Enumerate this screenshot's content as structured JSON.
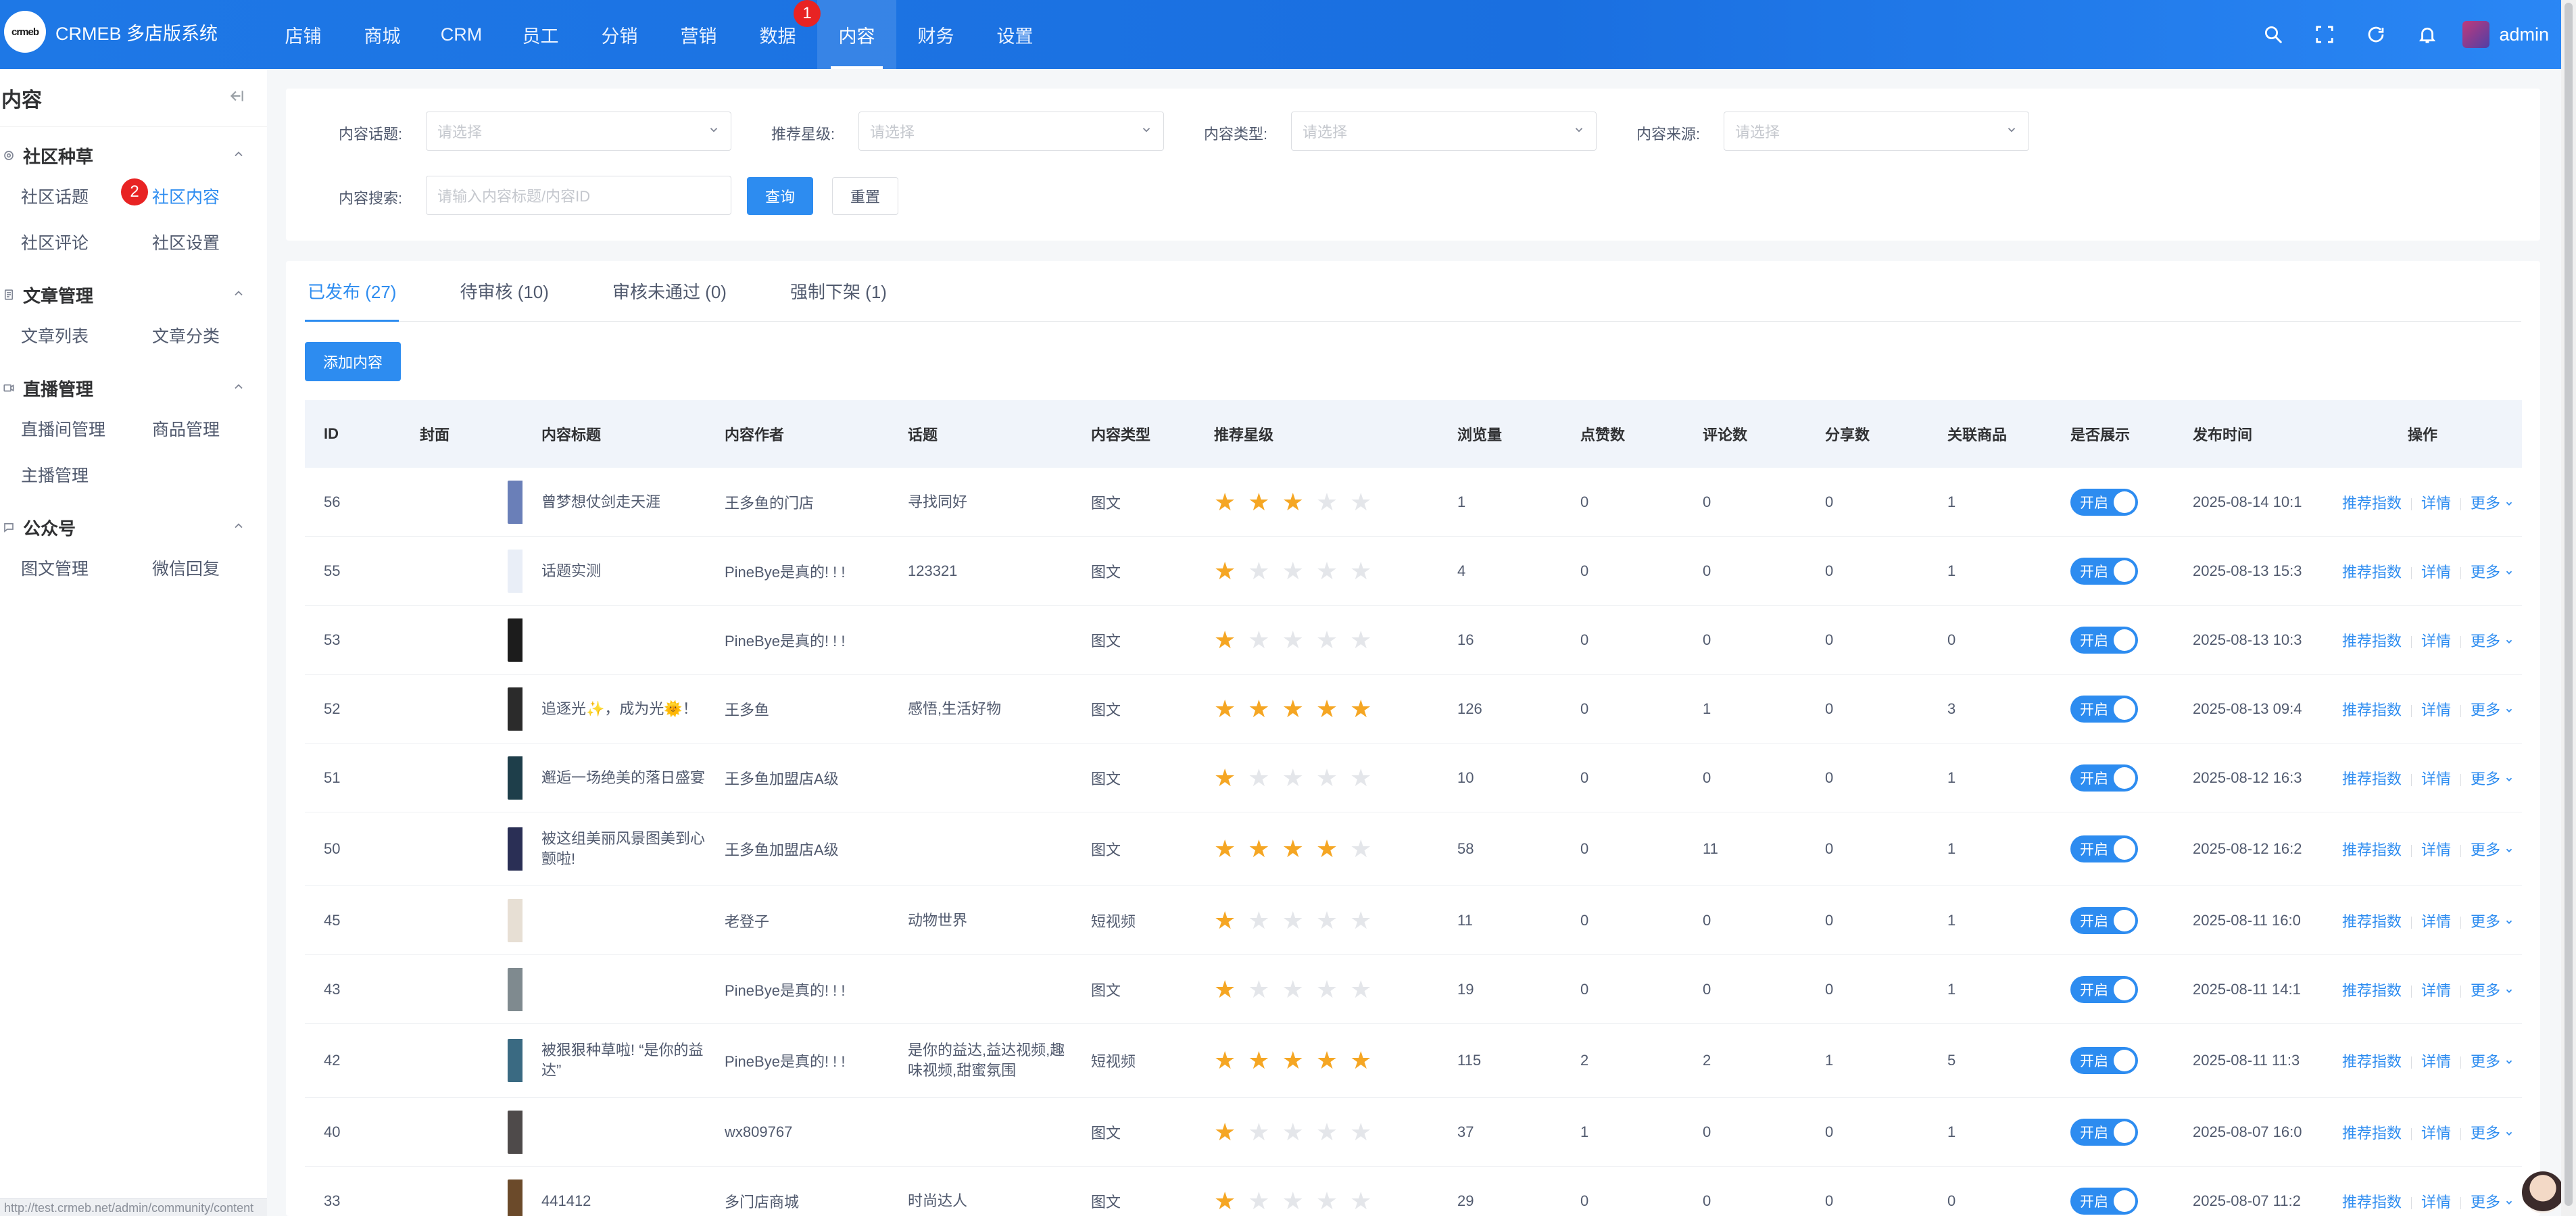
{
  "app": {
    "title": "CRMEB 多店版系统",
    "logo_text": "crmeb"
  },
  "topnav": [
    "店铺",
    "商城",
    "CRM",
    "员工",
    "分销",
    "营销",
    "数据",
    "内容",
    "财务",
    "设置"
  ],
  "topnav_active": "内容",
  "badges": {
    "one": "1",
    "two": "2"
  },
  "user": {
    "name": "admin"
  },
  "sidebar": {
    "title": "内容",
    "groups": [
      {
        "title": "社区种草",
        "icon": "circle-icon",
        "items": [
          "社区话题",
          "社区内容",
          "社区评论",
          "社区设置"
        ]
      },
      {
        "title": "文章管理",
        "icon": "document-icon",
        "items": [
          "文章列表",
          "文章分类"
        ]
      },
      {
        "title": "直播管理",
        "icon": "video-icon",
        "items": [
          "直播间管理",
          "商品管理",
          "主播管理"
        ]
      },
      {
        "title": "公众号",
        "icon": "chat-icon",
        "items": [
          "图文管理",
          "微信回复"
        ]
      }
    ],
    "active_item": "社区内容",
    "status_url": "http://test.crmeb.net/admin/community/content"
  },
  "search": {
    "topic_label": "内容话题:",
    "star_label": "推荐星级:",
    "type_label": "内容类型:",
    "source_label": "内容来源:",
    "keyword_label": "内容搜索:",
    "select_placeholder": "请选择",
    "keyword_placeholder": "请输入内容标题/内容ID",
    "query_button": "查询",
    "reset_button": "重置"
  },
  "tabs": [
    "已发布 (27)",
    "待审核 (10)",
    "审核未通过 (0)",
    "强制下架 (1)"
  ],
  "add_button": "添加内容",
  "table": {
    "headers": [
      "ID",
      "封面",
      "内容标题",
      "内容作者",
      "话题",
      "内容类型",
      "推荐星级",
      "浏览量",
      "点赞数",
      "评论数",
      "分享数",
      "关联商品",
      "是否展示",
      "发布时间",
      "操作"
    ],
    "switch_label": "开启",
    "op_labels": [
      "推荐指数",
      "详情",
      "更多"
    ],
    "rows": [
      {
        "id": "56",
        "cover": "#6a7fb8",
        "title": "曾梦想仗剑走天涯",
        "author": "王多鱼的门店",
        "topic": "寻找同好",
        "type": "图文",
        "stars": 3,
        "views": "1",
        "likes": "0",
        "comments": "0",
        "shares": "0",
        "goods": "1",
        "time": "2025-08-14 10:1"
      },
      {
        "id": "55",
        "cover": "#e9eef7",
        "title": "话题实测",
        "author": "PineBye是真的! ! !",
        "topic": "123321",
        "type": "图文",
        "stars": 1,
        "views": "4",
        "likes": "0",
        "comments": "0",
        "shares": "0",
        "goods": "1",
        "time": "2025-08-13 15:3"
      },
      {
        "id": "53",
        "cover": "#1c1c1c",
        "title": "",
        "author": "PineBye是真的! ! !",
        "topic": "",
        "type": "图文",
        "stars": 1,
        "views": "16",
        "likes": "0",
        "comments": "0",
        "shares": "0",
        "goods": "0",
        "time": "2025-08-13 10:3"
      },
      {
        "id": "52",
        "cover": "#2b2b2b",
        "title": "追逐光✨，成为光🌞！",
        "author": "王多鱼",
        "topic": "感悟,生活好物",
        "type": "图文",
        "stars": 5,
        "views": "126",
        "likes": "0",
        "comments": "1",
        "shares": "0",
        "goods": "3",
        "time": "2025-08-13 09:4"
      },
      {
        "id": "51",
        "cover": "#1e3e4a",
        "title": "邂逅一场绝美的落日盛宴",
        "author": "王多鱼加盟店A级",
        "topic": "",
        "type": "图文",
        "stars": 1,
        "views": "10",
        "likes": "0",
        "comments": "0",
        "shares": "0",
        "goods": "1",
        "time": "2025-08-12 16:3"
      },
      {
        "id": "50",
        "cover": "#2a2f55",
        "title": "被这组美丽风景图美到心颤啦!",
        "author": "王多鱼加盟店A级",
        "topic": "",
        "type": "图文",
        "stars": 4,
        "views": "58",
        "likes": "0",
        "comments": "11",
        "shares": "0",
        "goods": "1",
        "time": "2025-08-12 16:2"
      },
      {
        "id": "45",
        "cover": "#e7dfd4",
        "title": "",
        "author": "老登子",
        "topic": "动物世界",
        "type": "短视频",
        "stars": 1,
        "views": "11",
        "likes": "0",
        "comments": "0",
        "shares": "0",
        "goods": "1",
        "time": "2025-08-11 16:0"
      },
      {
        "id": "43",
        "cover": "#7f8a8f",
        "title": "",
        "author": "PineBye是真的! ! !",
        "topic": "",
        "type": "图文",
        "stars": 1,
        "views": "19",
        "likes": "0",
        "comments": "0",
        "shares": "0",
        "goods": "1",
        "time": "2025-08-11 14:1"
      },
      {
        "id": "42",
        "cover": "#3a6a82",
        "title": "被狠狠种草啦! “是你的益达”",
        "author": "PineBye是真的! ! !",
        "topic": "是你的益达,益达视频,趣味视频,甜蜜氛围",
        "type": "短视频",
        "stars": 5,
        "views": "115",
        "likes": "2",
        "comments": "2",
        "shares": "1",
        "goods": "5",
        "time": "2025-08-11 11:3"
      },
      {
        "id": "40",
        "cover": "#4e4a4a",
        "title": "",
        "author": "wx809767",
        "topic": "",
        "type": "图文",
        "stars": 1,
        "views": "37",
        "likes": "1",
        "comments": "0",
        "shares": "0",
        "goods": "1",
        "time": "2025-08-07 16:0"
      },
      {
        "id": "33",
        "cover": "#6b4a2a",
        "title": "441412",
        "author": "多门店商城",
        "topic": "时尚达人",
        "type": "图文",
        "stars": 1,
        "views": "29",
        "likes": "0",
        "comments": "0",
        "shares": "0",
        "goods": "0",
        "time": "2025-08-07 11:2"
      }
    ]
  }
}
